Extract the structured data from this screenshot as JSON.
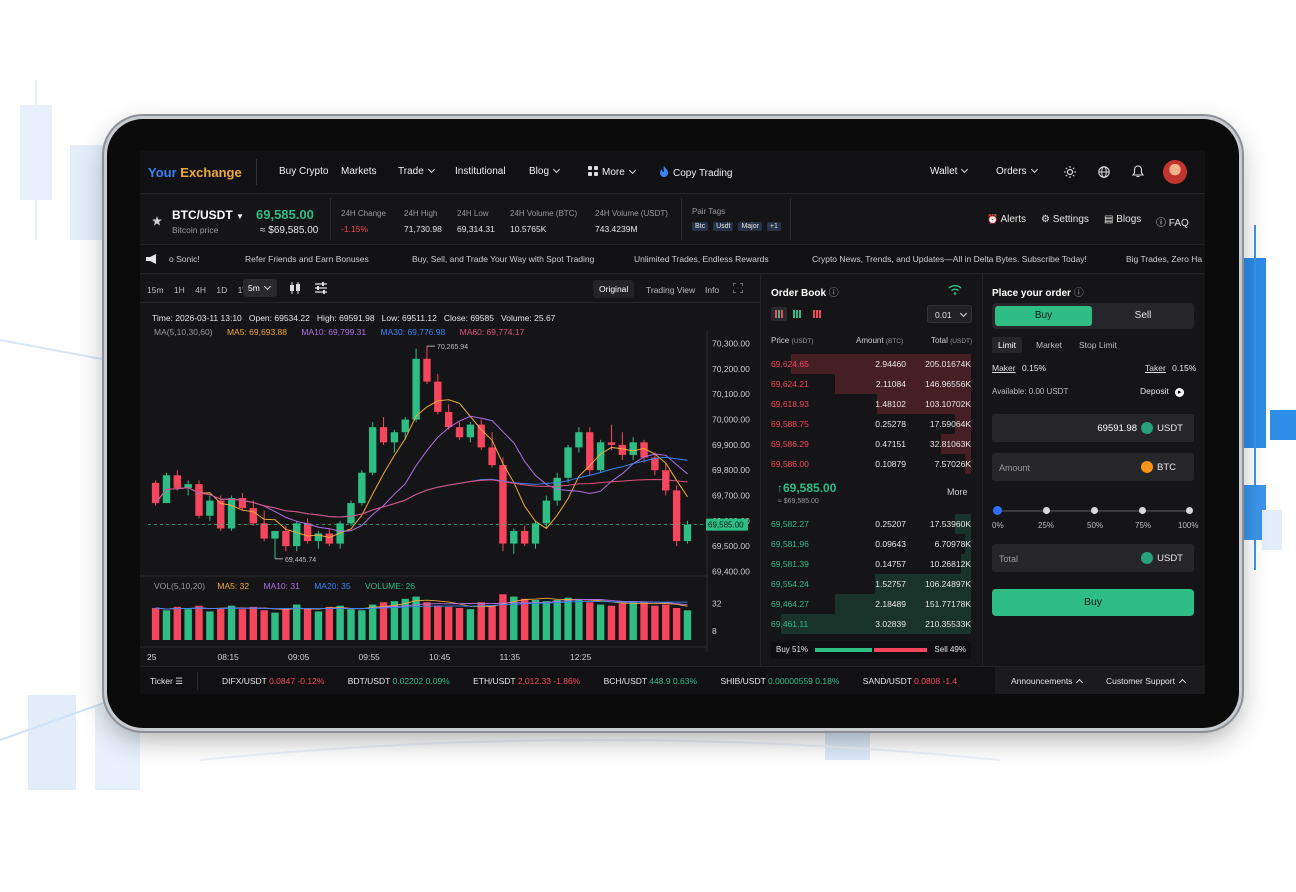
{
  "brand": {
    "part1": "Your",
    "part2": "Exchange",
    "color1": "#3b82f6",
    "color2": "#f0a93b"
  },
  "nav": {
    "buy_crypto": "Buy Crypto",
    "markets": "Markets",
    "trade": "Trade",
    "institutional": "Institutional",
    "blog": "Blog",
    "more": "More",
    "copy_trading": "Copy Trading",
    "wallet": "Wallet",
    "orders": "Orders"
  },
  "pair": {
    "symbol": "BTC/USDT",
    "price": "69,585.00",
    "subtitle": "Bitcoin price",
    "approx": "≈ $69,585.00"
  },
  "stats": [
    {
      "label": "24H Change",
      "value": "-1.15%",
      "color": "red"
    },
    {
      "label": "24H High",
      "value": "71,730.98"
    },
    {
      "label": "24H Low",
      "value": "69,314.31"
    },
    {
      "label": "24H Volume (BTC)",
      "value": "10.5765K"
    },
    {
      "label": "24H Volume (USDT)",
      "value": "743.4239M"
    }
  ],
  "pair_tags": {
    "label": "Pair Tags",
    "tags": [
      "Btc",
      "Usdt",
      "Major",
      "+1"
    ]
  },
  "tools": {
    "alerts": "Alerts",
    "settings": "Settings",
    "blogs": "Blogs",
    "faq": "FAQ"
  },
  "announcements_ticker": [
    "o Sonic!",
    "Refer Friends and Earn Bonuses",
    "Buy, Sell, and Trade Your Way with Spot Trading",
    "Unlimited Trades, Endless Rewards",
    "Crypto News, Trends, and Updates—All in Delta Bytes. Subscribe Today!",
    "Big Trades, Zero Ha"
  ],
  "chart_toolbar": {
    "intervals": [
      "15m",
      "1H",
      "4H",
      "1D",
      "1W"
    ],
    "selected": "5m",
    "views": [
      "Original",
      "Trading View",
      "Info"
    ]
  },
  "chart_legend": {
    "ohlc": "Time: 2026-03-11 13:10   Open: 69534.22   High: 69591.98   Low: 69511.12   Close: 69585   Volume: 25.67",
    "ma_label": "MA(5,10,30,60)",
    "ma5": "MA5: 69,693.88",
    "ma10": "MA10: 69,799.31",
    "ma30": "MA30: 69,776.98",
    "ma60": "MA60: 69,774.17",
    "vol_label": "VOL(5,10,20)",
    "vma5": "MA5: 32",
    "vma10": "MA10: 31",
    "vma20": "MA20: 35",
    "volume": "VOLUME: 26"
  },
  "chart_data": {
    "type": "candlestick",
    "y_ticks": [
      "70,300.00",
      "70,200.00",
      "70,100.00",
      "70,000.00",
      "69,900.00",
      "69,800.00",
      "69,700.00",
      "69,600.00",
      "69,500.00",
      "69,400.00"
    ],
    "ylim": [
      69390,
      70330
    ],
    "x_ticks": [
      "25",
      "08:15",
      "09:05",
      "09:55",
      "10:45",
      "11:35",
      "12:25"
    ],
    "current_price": "69,585.00",
    "max_label": "70,265.94",
    "min_label": "69,445.74",
    "volume_ticks": [
      "32",
      "8"
    ],
    "colors": {
      "up": "#2ebd85",
      "down": "#f6465d",
      "ma5": "#f0a93b",
      "ma10": "#b06ee6",
      "ma30": "#3b82f6",
      "ma60": "#e0507a"
    },
    "candles": [
      [
        69750,
        69760,
        69660,
        69670
      ],
      [
        69670,
        69790,
        69670,
        69780
      ],
      [
        69780,
        69800,
        69720,
        69730
      ],
      [
        69730,
        69760,
        69700,
        69745
      ],
      [
        69745,
        69760,
        69610,
        69620
      ],
      [
        69620,
        69700,
        69600,
        69680
      ],
      [
        69680,
        69700,
        69560,
        69570
      ],
      [
        69570,
        69700,
        69560,
        69690
      ],
      [
        69690,
        69710,
        69640,
        69650
      ],
      [
        69650,
        69680,
        69580,
        69590
      ],
      [
        69590,
        69640,
        69520,
        69530
      ],
      [
        69530,
        69560,
        69450,
        69560
      ],
      [
        69560,
        69580,
        69480,
        69500
      ],
      [
        69500,
        69600,
        69480,
        69590
      ],
      [
        69590,
        69610,
        69510,
        69520
      ],
      [
        69520,
        69560,
        69490,
        69550
      ],
      [
        69550,
        69570,
        69500,
        69510
      ],
      [
        69510,
        69600,
        69490,
        69590
      ],
      [
        69590,
        69680,
        69580,
        69670
      ],
      [
        69670,
        69800,
        69660,
        69790
      ],
      [
        69790,
        69990,
        69780,
        69970
      ],
      [
        69970,
        70010,
        69900,
        69910
      ],
      [
        69910,
        69960,
        69870,
        69950
      ],
      [
        69950,
        70010,
        69920,
        70000
      ],
      [
        70000,
        70280,
        69990,
        70240
      ],
      [
        70240,
        70290,
        70140,
        70150
      ],
      [
        70150,
        70180,
        70020,
        70030
      ],
      [
        70030,
        70060,
        69960,
        69970
      ],
      [
        69970,
        69990,
        69920,
        69930
      ],
      [
        69930,
        69990,
        69910,
        69980
      ],
      [
        69980,
        70000,
        69880,
        69890
      ],
      [
        69890,
        69950,
        69810,
        69820
      ],
      [
        69820,
        69850,
        69480,
        69510
      ],
      [
        69510,
        69570,
        69470,
        69560
      ],
      [
        69560,
        69580,
        69500,
        69510
      ],
      [
        69510,
        69600,
        69490,
        69590
      ],
      [
        69590,
        69700,
        69570,
        69680
      ],
      [
        69680,
        69790,
        69660,
        69770
      ],
      [
        69770,
        69900,
        69750,
        69890
      ],
      [
        69890,
        69970,
        69870,
        69950
      ],
      [
        69950,
        69970,
        69780,
        69800
      ],
      [
        69800,
        69920,
        69790,
        69910
      ],
      [
        69910,
        69980,
        69880,
        69900
      ],
      [
        69900,
        69950,
        69840,
        69860
      ],
      [
        69860,
        69930,
        69840,
        69910
      ],
      [
        69910,
        69920,
        69830,
        69850
      ],
      [
        69850,
        69870,
        69780,
        69800
      ],
      [
        69800,
        69830,
        69700,
        69720
      ],
      [
        69720,
        69740,
        69500,
        69520
      ],
      [
        69520,
        69600,
        69510,
        69585
      ]
    ],
    "volumes": [
      28,
      26,
      29,
      27,
      30,
      25,
      28,
      30,
      27,
      29,
      26,
      24,
      28,
      31,
      27,
      25,
      29,
      30,
      27,
      26,
      31,
      33,
      34,
      36,
      38,
      33,
      30,
      29,
      28,
      27,
      33,
      30,
      40,
      38,
      36,
      35,
      34,
      35,
      37,
      36,
      33,
      31,
      30,
      32,
      34,
      33,
      30,
      31,
      28,
      26
    ]
  },
  "order_book": {
    "title": "Order Book",
    "precision": "0.01",
    "col_price": "Price",
    "col_price_unit": "(USDT)",
    "col_amount": "Amount",
    "col_amount_unit": "(BTC)",
    "col_total": "Total",
    "col_total_unit": "(USDT)",
    "asks": [
      {
        "price": "69,624.65",
        "amount": "2.94460",
        "total": "205.01674K",
        "depth": 0.9
      },
      {
        "price": "69,624.21",
        "amount": "2.11084",
        "total": "146.96556K",
        "depth": 0.68
      },
      {
        "price": "69,618.93",
        "amount": "1.48102",
        "total": "103.10702K",
        "depth": 0.47
      },
      {
        "price": "69,588.75",
        "amount": "0.25278",
        "total": "17.59064K",
        "depth": 0.08
      },
      {
        "price": "69,586.29",
        "amount": "0.47151",
        "total": "32.81063K",
        "depth": 0.15
      },
      {
        "price": "69,586.00",
        "amount": "0.10879",
        "total": "7.57026K",
        "depth": 0.03
      }
    ],
    "mid_price": "69,585.00",
    "mid_sub": "≈ $69,585.00",
    "more": "More",
    "bids": [
      {
        "price": "69,582.27",
        "amount": "0.25207",
        "total": "17.53960K",
        "depth": 0.08
      },
      {
        "price": "69,581.96",
        "amount": "0.09643",
        "total": "6.70978K",
        "depth": 0.03
      },
      {
        "price": "69,581.39",
        "amount": "0.14757",
        "total": "10.26812K",
        "depth": 0.05
      },
      {
        "price": "69,554.24",
        "amount": "1.52757",
        "total": "106.24897K",
        "depth": 0.48
      },
      {
        "price": "69,464.27",
        "amount": "2.18489",
        "total": "151.77178K",
        "depth": 0.68
      },
      {
        "price": "69,461.11",
        "amount": "3.02839",
        "total": "210.35533K",
        "depth": 0.95
      }
    ],
    "buy_ratio": "Buy 51%",
    "sell_ratio": "Sell 49%",
    "buy_pct": 51
  },
  "order_form": {
    "title": "Place your order",
    "buy_tab": "Buy",
    "sell_tab": "Sell",
    "types": [
      "Limit",
      "Market",
      "Stop Limit"
    ],
    "maker_label": "Maker",
    "maker_fee": "0.15%",
    "taker_label": "Taker",
    "taker_fee": "0.15%",
    "available": "Available: 0.00 USDT",
    "deposit": "Deposit",
    "price_value": "69591.98",
    "price_unit": "USDT",
    "amount_placeholder": "Amount",
    "amount_unit": "BTC",
    "slider_marks": [
      "0%",
      "25%",
      "50%",
      "75%",
      "100%"
    ],
    "slider_value": 0,
    "total_placeholder": "Total",
    "total_unit": "USDT",
    "submit": "Buy"
  },
  "bottom_ticker": {
    "label": "Ticker",
    "items": [
      {
        "pair": "DIFX/USDT",
        "price": "0.0847",
        "change": "-0.12%",
        "color": "red"
      },
      {
        "pair": "BDT/USDT",
        "price": "0.02202",
        "change": "0.09%",
        "color": "green"
      },
      {
        "pair": "ETH/USDT",
        "price": "2,012.33",
        "change": "-1.86%",
        "color": "red"
      },
      {
        "pair": "BCH/USDT",
        "price": "448.9",
        "change": "0.63%",
        "color": "green"
      },
      {
        "pair": "SHIB/USDT",
        "price": "0.00000559",
        "change": "0.18%",
        "color": "green"
      },
      {
        "pair": "SAND/USDT",
        "price": "0.0808",
        "change": "-1.4",
        "color": "red"
      }
    ],
    "announcements": "Announcements",
    "support": "Customer Support"
  }
}
